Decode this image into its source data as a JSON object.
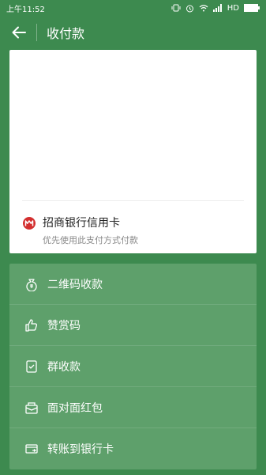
{
  "status": {
    "time": "上午11:52",
    "network": "HD"
  },
  "header": {
    "title": "收付款"
  },
  "payment": {
    "bank_name": "招商银行信用卡",
    "hint": "优先使用此支付方式付款"
  },
  "menu": {
    "items": [
      {
        "label": "二维码收款",
        "icon": "money-bag-icon"
      },
      {
        "label": "赞赏码",
        "icon": "thumbs-up-icon"
      },
      {
        "label": "群收款",
        "icon": "group-collect-icon"
      },
      {
        "label": "面对面红包",
        "icon": "red-envelope-icon"
      },
      {
        "label": "转账到银行卡",
        "icon": "bank-card-transfer-icon"
      }
    ]
  },
  "colors": {
    "background": "#3d8a4f",
    "menu_panel": "#5ea06b",
    "bank_logo": "#d32f2f"
  }
}
